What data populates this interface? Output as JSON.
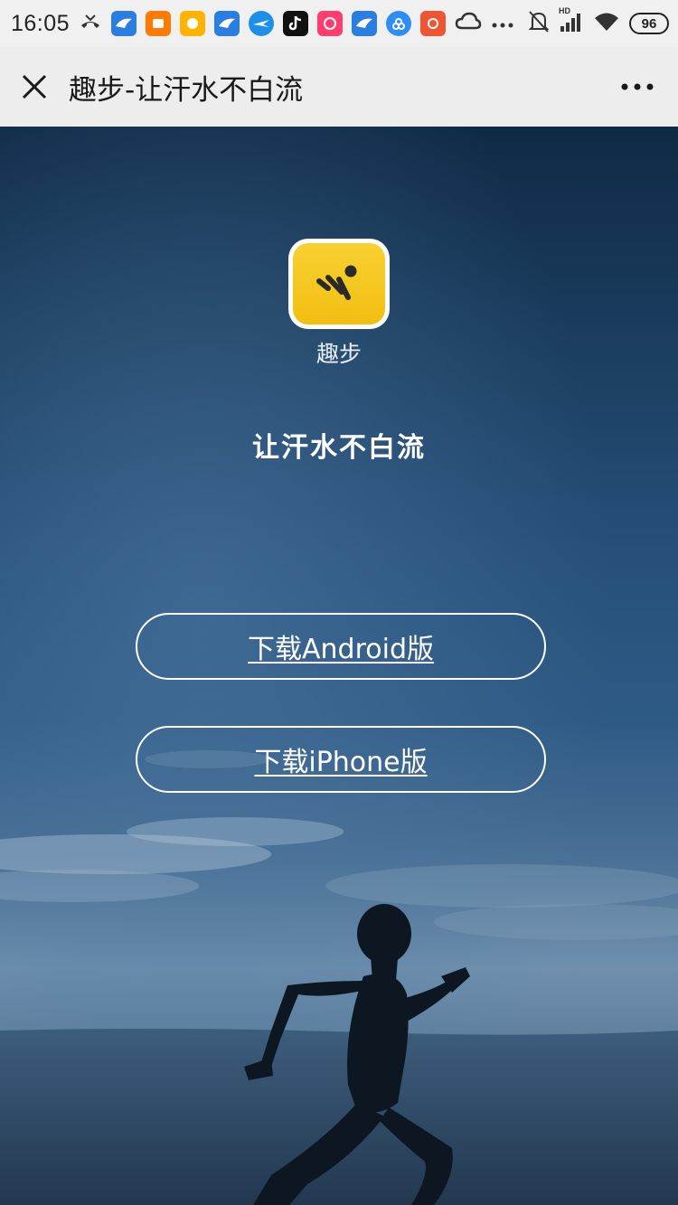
{
  "status_bar": {
    "time": "16:05",
    "battery_level": "96",
    "notification_icons": [
      "missed-call-icon",
      "app-notification-icon",
      "taobao-icon",
      "app-notification-icon",
      "app-notification-icon",
      "app-notification-icon",
      "tiktok-icon",
      "app-notification-icon",
      "app-notification-icon",
      "app-notification-icon",
      "app-notification-icon",
      "cloud-icon",
      "more-dots-icon"
    ],
    "right_icons": [
      "mute-icon",
      "signal-icon",
      "wifi-icon",
      "battery-icon"
    ],
    "signal_label": "HD"
  },
  "nav_bar": {
    "title": "趣步-让汗水不白流"
  },
  "hero": {
    "app_name": "趣步",
    "slogan": "让汗水不白流",
    "buttons": {
      "android_label": "下载Android版",
      "iphone_label": "下载iPhone版"
    }
  },
  "colors": {
    "logo_yellow": "#f4c51e",
    "sky_top": "#0f2a45",
    "sky_mid": "#2d5a84",
    "horizon": "#6f8fad",
    "nav_bg": "#ededed"
  }
}
